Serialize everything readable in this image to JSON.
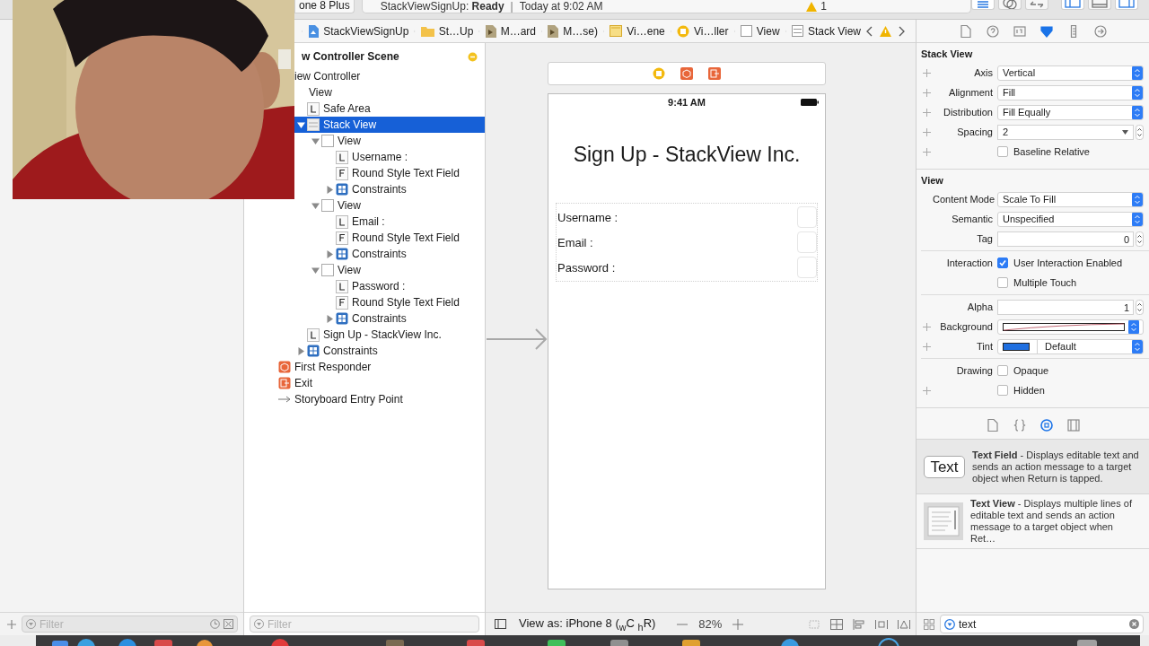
{
  "toolbar": {
    "scheme": "one 8 Plus",
    "activity": "StackViewSignUp: **Ready**",
    "separator": "|",
    "time": "Today at 9:02 AM",
    "warning_count": "1",
    "buttons": [
      {
        "kind": "standard",
        "selected": true
      },
      {
        "kind": "assistant",
        "selected": false
      },
      {
        "kind": "version",
        "selected": false
      },
      {
        "kind": "navigator",
        "selected": true
      },
      {
        "kind": "debug",
        "selected": false
      },
      {
        "kind": "utilities",
        "selected": true
      }
    ]
  },
  "jump_bar": [
    {
      "label": "StackViewSignUp",
      "kind": "project"
    },
    {
      "label": "St…Up",
      "kind": "folder"
    },
    {
      "label": "M…ard",
      "kind": "storyboard"
    },
    {
      "label": "M…se)",
      "kind": "storyboard"
    },
    {
      "label": "Vi…ene",
      "kind": "scene"
    },
    {
      "label": "Vi…ller",
      "kind": "controller"
    },
    {
      "label": "View",
      "kind": "view"
    },
    {
      "label": "Stack View",
      "kind": "stack"
    }
  ],
  "navigator": {
    "filter_placeholder": "Filter"
  },
  "outline": {
    "scene_title": "w Controller Scene",
    "filter_placeholder": "Filter",
    "items": [
      {
        "label": "iew Controller",
        "selected": false,
        "children": [
          {
            "label": "View",
            "selected": false,
            "children": [
              {
                "label": "Safe Area",
                "kind": "label",
                "selected": false
              },
              {
                "label": "Stack View",
                "kind": "stack",
                "selected": true,
                "expanded": true,
                "children": [
                  {
                    "label": "View",
                    "kind": "view",
                    "selected": false,
                    "expanded": true,
                    "children": [
                      {
                        "label": "Username :",
                        "kind": "label",
                        "selected": false
                      },
                      {
                        "label": "Round Style Text Field",
                        "kind": "field",
                        "selected": false
                      },
                      {
                        "label": "Constraints",
                        "kind": "constraints",
                        "selected": false,
                        "expanded": false
                      }
                    ]
                  },
                  {
                    "label": "View",
                    "kind": "view",
                    "selected": false,
                    "expanded": true,
                    "children": [
                      {
                        "label": "Email :",
                        "kind": "label",
                        "selected": false
                      },
                      {
                        "label": "Round Style Text Field",
                        "kind": "field",
                        "selected": false
                      },
                      {
                        "label": "Constraints",
                        "kind": "constraints",
                        "selected": false,
                        "expanded": false
                      }
                    ]
                  },
                  {
                    "label": "View",
                    "kind": "view",
                    "selected": false,
                    "expanded": true,
                    "children": [
                      {
                        "label": "Password :",
                        "kind": "label",
                        "selected": false
                      },
                      {
                        "label": "Round Style Text Field",
                        "kind": "field",
                        "selected": false
                      },
                      {
                        "label": "Constraints",
                        "kind": "constraints",
                        "selected": false,
                        "expanded": false
                      }
                    ]
                  }
                ]
              },
              {
                "label": "Sign Up - StackView Inc.",
                "kind": "label",
                "selected": false
              },
              {
                "label": "Constraints",
                "kind": "constraints",
                "selected": false,
                "expanded": false
              }
            ]
          }
        ]
      },
      {
        "label": "First Responder",
        "kind": "responder",
        "selected": false
      },
      {
        "label": "Exit",
        "kind": "exit",
        "selected": false
      },
      {
        "label": "Storyboard Entry Point",
        "kind": "entry",
        "selected": false
      }
    ]
  },
  "canvas": {
    "status_time": "9:41 AM",
    "title": "Sign Up - StackView Inc.",
    "labels": [
      "Username :",
      "Email :",
      "Password :"
    ],
    "view_as": "View as: iPhone 8 ($_{w}$C $_{h}$R)",
    "zoom": "82%"
  },
  "inspector": {
    "tabs": [
      {
        "kind": "file",
        "selected": false
      },
      {
        "kind": "help",
        "selected": false
      },
      {
        "kind": "identity",
        "selected": false
      },
      {
        "kind": "attributes",
        "selected": true
      },
      {
        "kind": "size",
        "selected": false
      },
      {
        "kind": "connections",
        "selected": false
      }
    ],
    "sections": [
      {
        "title": "Stack View",
        "groups": [
          [
            {
              "kind": "select",
              "label": "Axis",
              "value": "Vertical",
              "plus": true
            },
            {
              "kind": "select",
              "label": "Alignment",
              "value": "Fill",
              "plus": true
            },
            {
              "kind": "select",
              "label": "Distribution",
              "value": "Fill Equally",
              "plus": true
            },
            {
              "kind": "combo",
              "label": "Spacing",
              "value": "2",
              "plus": true
            },
            {
              "kind": "checkbox",
              "text": "Baseline Relative",
              "checked": false,
              "plus": true
            }
          ]
        ]
      },
      {
        "title": "View",
        "groups": [
          [
            {
              "kind": "select",
              "label": "Content Mode",
              "value": "Scale To Fill",
              "plus": false
            },
            {
              "kind": "select",
              "label": "Semantic",
              "value": "Unspecified",
              "plus": false
            },
            {
              "kind": "number",
              "label": "Tag",
              "value": "0",
              "plus": false
            }
          ],
          [
            {
              "kind": "checkbox",
              "label": "Interaction",
              "text": "User Interaction Enabled",
              "checked": true,
              "plus": false
            },
            {
              "kind": "checkbox",
              "text": "Multiple Touch",
              "checked": false,
              "plus": false
            }
          ],
          [
            {
              "kind": "number",
              "label": "Alpha",
              "value": "1",
              "plus": false
            },
            {
              "kind": "clear_color",
              "label": "Background",
              "plus": true
            },
            {
              "kind": "color_select",
              "label": "Tint",
              "value": "Default",
              "color": "#1f6fe0",
              "plus": true
            }
          ],
          [
            {
              "kind": "checkbox",
              "label": "Drawing",
              "text": "Opaque",
              "checked": false,
              "plus": false
            },
            {
              "kind": "checkbox",
              "text": "Hidden",
              "checked": false,
              "plus": true
            }
          ]
        ]
      }
    ]
  },
  "library": {
    "tabs": [
      {
        "kind": "file",
        "selected": false
      },
      {
        "kind": "code",
        "selected": false
      },
      {
        "kind": "object",
        "selected": true
      },
      {
        "kind": "media",
        "selected": false
      }
    ],
    "items": [
      {
        "kind": "text_field",
        "thumb": "Text",
        "description": "**Text Field** - Displays editable text and sends an action message to a target object when Return is tapped.",
        "selected": true
      },
      {
        "kind": "text_view",
        "description": "**Text View** - Displays multiple lines of editable text and sends an action message to a target object when Ret…",
        "selected": false
      }
    ],
    "search": "text"
  }
}
